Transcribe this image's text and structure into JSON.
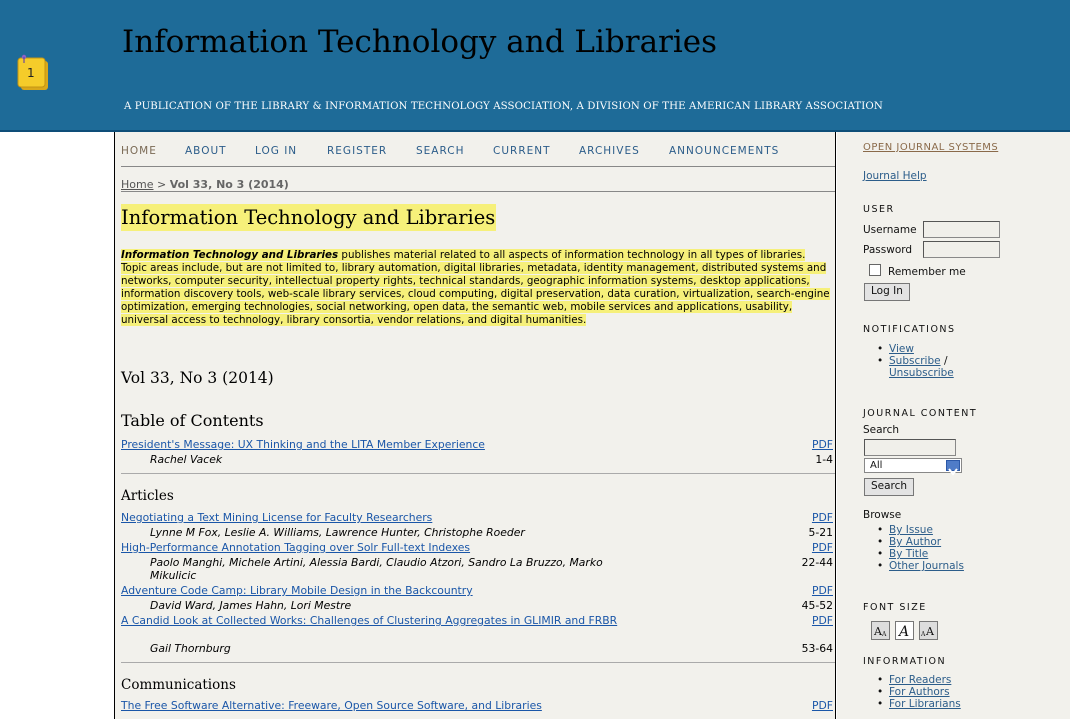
{
  "header": {
    "title": "Information Technology and Libraries",
    "subtitle": "A PUBLICATION OF THE LIBRARY & INFORMATION TECHNOLOGY ASSOCIATION, A DIVISION OF THE AMERICAN LIBRARY ASSOCIATION",
    "note_badge": "1"
  },
  "nav": {
    "items": [
      "HOME",
      "ABOUT",
      "LOG IN",
      "REGISTER",
      "SEARCH",
      "CURRENT",
      "ARCHIVES",
      "ANNOUNCEMENTS"
    ]
  },
  "breadcrumb": {
    "home": "Home",
    "separator": ">",
    "current": "Vol 33, No 3 (2014)"
  },
  "journal": {
    "title": "Information Technology and Libraries",
    "description_lead": "Information Technology and Libraries",
    "description_rest": " publishes material related to all aspects of information technology in all types of libraries. Topic areas include, but are not limited to, library automation, digital libraries, metadata, identity management, distributed systems and networks, computer security, intellectual property rights, technical standards, geographic information systems, desktop applications, information discovery tools, web-scale library services, cloud computing, digital preservation, data curation, virtualization, search-engine optimization, emerging technologies, social networking, open data, the semantic web, mobile services and applications, usability, universal access to technology, library consortia, vendor relations, and digital humanities."
  },
  "issue": {
    "heading": "Vol 33, No 3 (2014)",
    "toc_heading": "Table of Contents",
    "intro": {
      "title": "President's Message: UX Thinking and the LITA Member Experience",
      "pdf": "PDF",
      "authors": "Rachel Vacek",
      "pages": "1-4"
    },
    "sections": {
      "articles": "Articles",
      "communications": "Communications"
    },
    "articles": [
      {
        "title": "Negotiating a Text Mining License for Faculty Researchers",
        "pdf": "PDF",
        "authors": "Lynne M Fox, Leslie A. Williams, Lawrence Hunter, Christophe Roeder",
        "pages": "5-21"
      },
      {
        "title": "High-Performance Annotation Tagging over Solr Full-text Indexes",
        "pdf": "PDF",
        "authors": "Paolo Manghi, Michele Artini, Alessia Bardi, Claudio Atzori, Sandro La Bruzzo, Marko Mikulicic",
        "pages": "22-44"
      },
      {
        "title": "Adventure Code Camp: Library Mobile Design in the Backcountry",
        "pdf": "PDF",
        "authors": "David Ward, James Hahn, Lori Mestre",
        "pages": "45-52"
      },
      {
        "title": "A Candid Look at Collected Works: Challenges of Clustering Aggregates in GLIMIR and FRBR",
        "pdf": "PDF",
        "authors": "Gail Thornburg",
        "pages": "53-64"
      }
    ],
    "communications": [
      {
        "title": "The Free Software Alternative: Freeware, Open Source Software, and Libraries",
        "pdf": "PDF"
      }
    ]
  },
  "sidebar": {
    "ojs_link": "OPEN JOURNAL SYSTEMS",
    "help_link": "Journal Help",
    "user": {
      "heading": "USER",
      "username_label": "Username",
      "password_label": "Password",
      "remember_label": "Remember me",
      "login_button": "Log In"
    },
    "notifications": {
      "heading": "NOTIFICATIONS",
      "view": "View",
      "subscribe": "Subscribe",
      "slash": "/",
      "unsubscribe": "Unsubscribe"
    },
    "journal_content": {
      "heading": "JOURNAL CONTENT",
      "search_label": "Search",
      "scope_selected": "All",
      "search_button": "Search",
      "browse_label": "Browse",
      "browse_items": [
        "By Issue",
        "By Author",
        "By Title",
        "Other Journals"
      ]
    },
    "font_size": {
      "heading": "FONT SIZE"
    },
    "information": {
      "heading": "INFORMATION",
      "items": [
        "For Readers",
        "For Authors",
        "For Librarians"
      ]
    }
  }
}
